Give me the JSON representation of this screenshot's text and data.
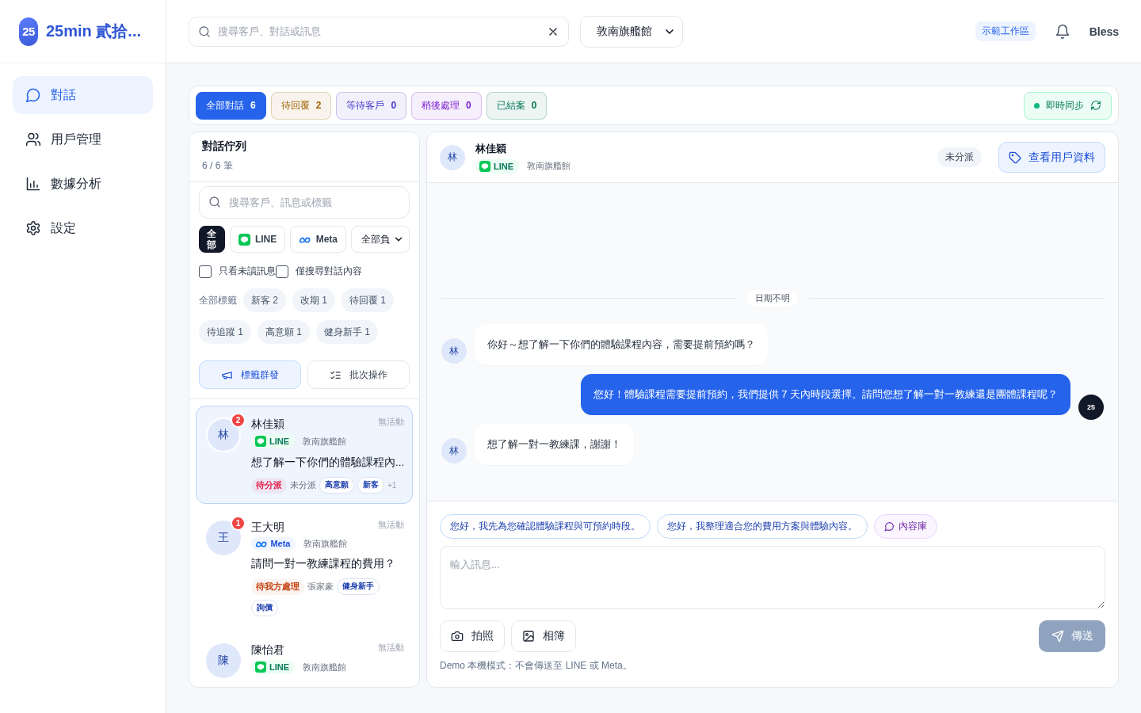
{
  "brand": {
    "logo": "25",
    "name": "25min 貳拾..."
  },
  "nav": [
    {
      "label": "對話",
      "kind": "chat",
      "selected": true
    },
    {
      "label": "用戶管理",
      "kind": "users",
      "selected": false
    },
    {
      "label": "數據分析",
      "kind": "chart",
      "selected": false
    },
    {
      "label": "設定",
      "kind": "gear",
      "selected": false
    }
  ],
  "topbar": {
    "search": {
      "placeholder": "搜尋客戶、對話或訊息"
    },
    "store": "敦南旗艦館",
    "workspace": "示範工作區",
    "user": "Bless"
  },
  "status_tabs": [
    {
      "label": "全部對話",
      "count": "6",
      "color": "#2563eb",
      "selected": true
    },
    {
      "label": "待回覆",
      "count": "2",
      "color": "#a16207",
      "selected": false
    },
    {
      "label": "等待客戶",
      "count": "0",
      "color": "#4338ca",
      "selected": false
    },
    {
      "label": "稍後處理",
      "count": "0",
      "color": "#7e22ce",
      "selected": false
    },
    {
      "label": "已結案",
      "count": "0",
      "color": "#047857",
      "selected": false
    }
  ],
  "sync": {
    "label": "即時同步",
    "on": true
  },
  "queue": {
    "title": "對話佇列",
    "count": "6 / 6 筆",
    "search": {
      "placeholder": "搜尋客戶、訊息或標籤"
    },
    "channels": [
      {
        "label": "全部",
        "kind": "all",
        "selected": true
      },
      {
        "label": "LINE",
        "kind": "line",
        "selected": false
      },
      {
        "label": "Meta",
        "kind": "meta",
        "selected": false
      }
    ],
    "owner": "全部負",
    "filters": [
      {
        "label": "只看未讀訊息",
        "checked": false
      },
      {
        "label": "僅搜尋對話內容",
        "checked": false
      }
    ],
    "tags_label": "全部標籤",
    "tags": [
      {
        "label": "新客 2"
      },
      {
        "label": "改期 1"
      },
      {
        "label": "待回覆 1"
      },
      {
        "label": "待追蹤 1"
      },
      {
        "label": "高意願 1"
      },
      {
        "label": "健身新手 1"
      }
    ],
    "actions": [
      {
        "label": "標籤群發",
        "kind": "broadcast"
      },
      {
        "label": "批次操作",
        "kind": "batch"
      }
    ],
    "conversations": [
      {
        "avatar": "林",
        "unread": "2",
        "name": "林佳穎",
        "time": "無活動",
        "channel": {
          "kind": "line",
          "label": "LINE"
        },
        "store": "敦南旗艦館",
        "preview": "想了解一下你們的體驗課程內...",
        "status": {
          "label": "待分派",
          "color": "#e11d48"
        },
        "assignee": "未分派",
        "tags": [
          "高意願",
          "新客"
        ],
        "more": "+1",
        "selected": true
      },
      {
        "avatar": "王",
        "unread": "1",
        "name": "王大明",
        "time": "無活動",
        "channel": {
          "kind": "meta",
          "label": "Meta"
        },
        "store": "敦南旗艦館",
        "preview": "請問一對一教練課程的費用？",
        "status": {
          "label": "待我方處理",
          "color": "#c2410c"
        },
        "assignee": "張家豪",
        "tags": [
          "健身新手",
          "詢價"
        ],
        "selected": false
      },
      {
        "avatar": "陳",
        "name": "陳怡君",
        "time": "無活動",
        "channel": {
          "kind": "line",
          "label": "LINE"
        },
        "store": "敦南旗艦館",
        "selected": false
      }
    ]
  },
  "chat": {
    "avatar": "林",
    "name": "林佳穎",
    "channel": {
      "kind": "line",
      "label": "LINE"
    },
    "store": "敦南旗艦館",
    "assignee": "未分派",
    "profile_button": "查看用戶資料",
    "date_divider": "日期不明",
    "messages": [
      {
        "kind": "customer",
        "avatar": "林",
        "text": "你好～想了解一下你們的體驗課程內容，需要提前預約嗎？"
      },
      {
        "kind": "agent",
        "avatar": "25",
        "text": "您好！體驗課程需要提前預約，我們提供 7 天內時段選擇。請問您想了解一對一教練還是團體課程呢？"
      },
      {
        "kind": "customer",
        "avatar": "林",
        "text": "想了解一對一教練課，謝謝！"
      }
    ],
    "quick_replies": [
      {
        "label": "您好，我先為您確認體驗課程與可預約時段。",
        "kind": "reply"
      },
      {
        "label": "您好，我整理適合您的費用方案與體驗內容。",
        "kind": "reply"
      },
      {
        "label": "內容庫",
        "kind": "library"
      }
    ],
    "input": {
      "placeholder": "輸入訊息..."
    },
    "attachments": [
      {
        "label": "拍照",
        "kind": "camera"
      },
      {
        "label": "相簿",
        "kind": "album"
      }
    ],
    "send": {
      "label": "傳送",
      "disabled": true
    },
    "note": "Demo 本機模式：不會傳送至 LINE 或 Meta。"
  }
}
